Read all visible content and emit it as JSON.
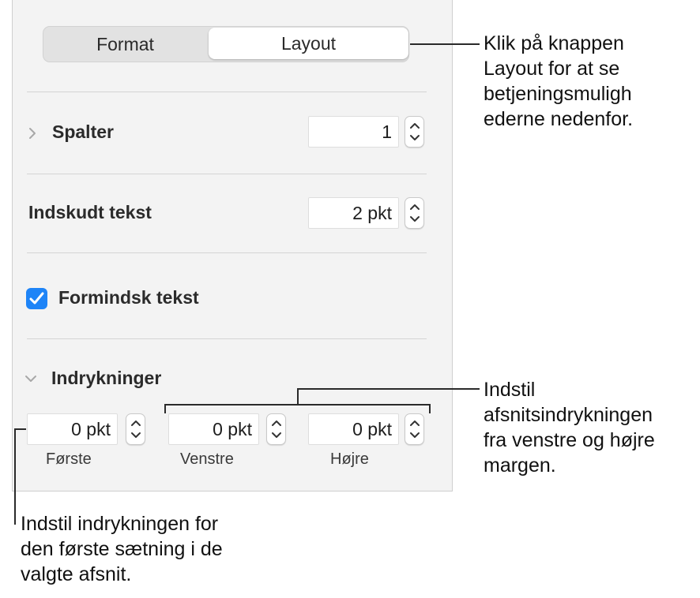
{
  "tabs": {
    "format": "Format",
    "layout": "Layout"
  },
  "columns": {
    "label": "Spalter",
    "value": "1"
  },
  "inset": {
    "label": "Indskudt tekst",
    "value": "2 pkt"
  },
  "shrink": {
    "label": "Formindsk tekst",
    "checked": true
  },
  "indents": {
    "label": "Indrykninger",
    "first": {
      "value": "0 pkt",
      "label": "Første"
    },
    "left": {
      "value": "0 pkt",
      "label": "Venstre"
    },
    "right": {
      "value": "0 pkt",
      "label": "Højre"
    }
  },
  "callouts": {
    "layout": [
      "Klik på knappen",
      "Layout for at se",
      "betjeningsmuligh",
      "ederne nedenfor."
    ],
    "margins": [
      "Indstil",
      "afsnitsindrykningen",
      "fra venstre og højre",
      "margen."
    ],
    "first": [
      "Indstil indrykningen for",
      "den første sætning i de",
      "valgte afsnit."
    ]
  },
  "accent_color": "#1e84f7"
}
